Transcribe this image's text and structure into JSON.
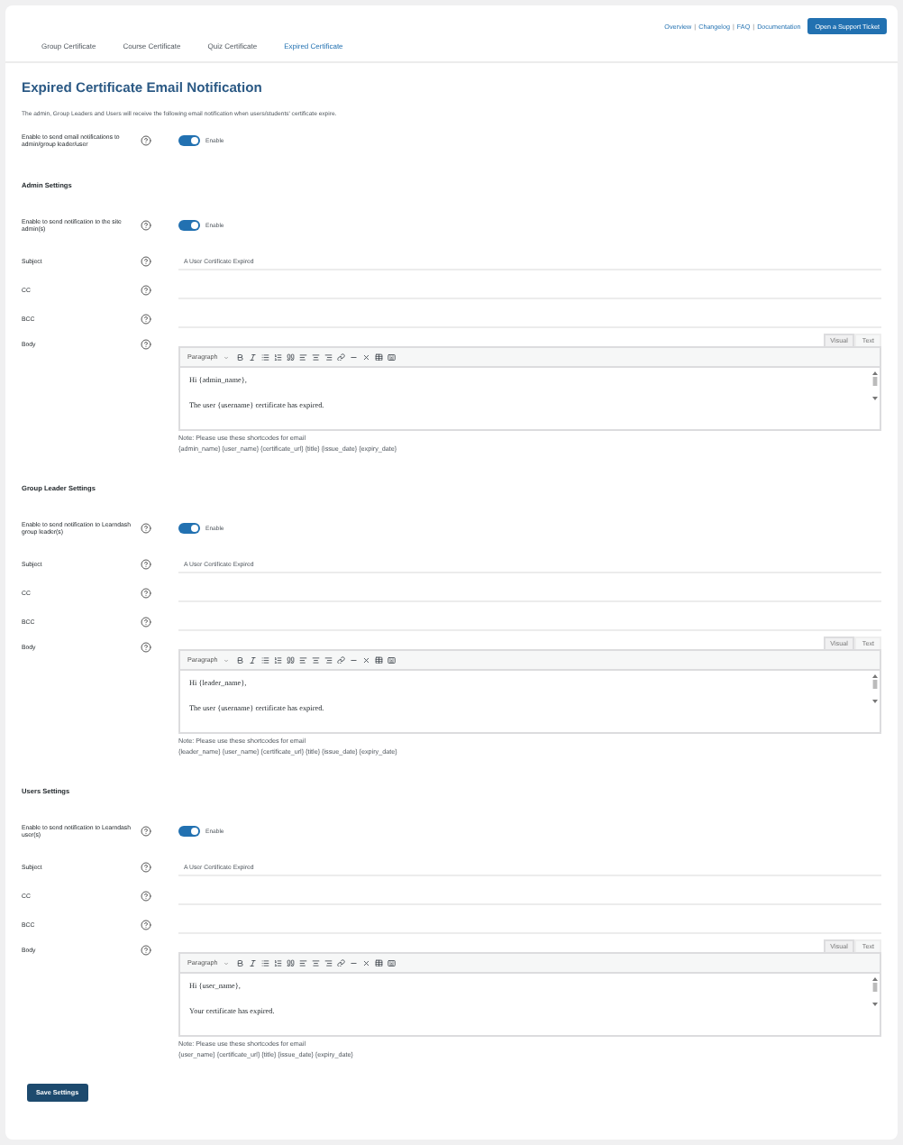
{
  "header": {
    "links": [
      {
        "kind": "link",
        "label": "Overview"
      },
      {
        "kind": "separator",
        "label": "|"
      },
      {
        "kind": "link",
        "label": "Changelog"
      },
      {
        "kind": "separator",
        "label": "|"
      },
      {
        "kind": "link",
        "label": "FAQ"
      },
      {
        "kind": "separator",
        "label": "|"
      },
      {
        "kind": "link",
        "label": "Documentation"
      }
    ],
    "support_button": "Open a Support Ticket"
  },
  "tabs": [
    {
      "label": "Group Certificate",
      "selected": false
    },
    {
      "label": "Course Certificate",
      "selected": false
    },
    {
      "label": "Quiz Certificate",
      "selected": false
    },
    {
      "label": "Expired Certificate",
      "selected": true
    }
  ],
  "title": "Expired Certificate Email Notification",
  "description": "The admin, Group Leaders and Users will receive the following email notification when users/students' certificate expire.",
  "master": {
    "label": "Enable to send email notifications to admin/group leader/user",
    "on": true,
    "toggle_label": "Enable"
  },
  "sections": [
    {
      "heading": "Admin Settings",
      "enable": {
        "label": "Enable to send notification to the site admin(s)",
        "on": true,
        "toggle_label": "Enable"
      },
      "fields": [
        {
          "label": "Subject",
          "value": "A User Certificate Expired"
        },
        {
          "label": "CC"
        },
        {
          "label": "BCC"
        }
      ],
      "body": {
        "label": "Body",
        "editor_tabs": [
          {
            "label": "Visual",
            "selected": true
          },
          {
            "label": "Text",
            "selected": false
          }
        ],
        "format": "Paragraph",
        "lines": [
          "Hi {admin_name},",
          "The user {username} certificate has expired."
        ],
        "note": "Note: Please use these shortcodes for email",
        "shortcodes": "{admin_name} {user_name} {certificate_url} {title} {issue_date} {expiry_date}"
      }
    },
    {
      "heading": "Group Leader Settings",
      "enable": {
        "label": "Enable to send notification to Learndash group leader(s)",
        "on": true,
        "toggle_label": "Enable"
      },
      "fields": [
        {
          "label": "Subject",
          "value": "A User Certificate Expired"
        },
        {
          "label": "CC"
        },
        {
          "label": "BCC"
        }
      ],
      "body": {
        "label": "Body",
        "editor_tabs": [
          {
            "label": "Visual",
            "selected": true
          },
          {
            "label": "Text",
            "selected": false
          }
        ],
        "format": "Paragraph",
        "lines": [
          "Hi {leader_name},",
          "The user {username} certificate has expired."
        ],
        "note": "Note: Please use these shortcodes for email",
        "shortcodes": "{leader_name} {user_name} {certificate_url} {title} {issue_date} {expiry_date}"
      }
    },
    {
      "heading": "Users Settings",
      "enable": {
        "label": "Enable to send notification to Learndash user(s)",
        "on": true,
        "toggle_label": "Enable"
      },
      "fields": [
        {
          "label": "Subject",
          "value": "A User Certificate Expired"
        },
        {
          "label": "CC"
        },
        {
          "label": "BCC"
        }
      ],
      "body": {
        "label": "Body",
        "editor_tabs": [
          {
            "label": "Visual",
            "selected": true
          },
          {
            "label": "Text",
            "selected": false
          }
        ],
        "format": "Paragraph",
        "lines": [
          "Hi {user_name},",
          "Your certificate has expired."
        ],
        "note": "Note: Please use these shortcodes for email",
        "shortcodes": "{user_name} {certificate_url} {title} {issue_date} {expiry_date}"
      }
    }
  ],
  "save_button": "Save Settings"
}
